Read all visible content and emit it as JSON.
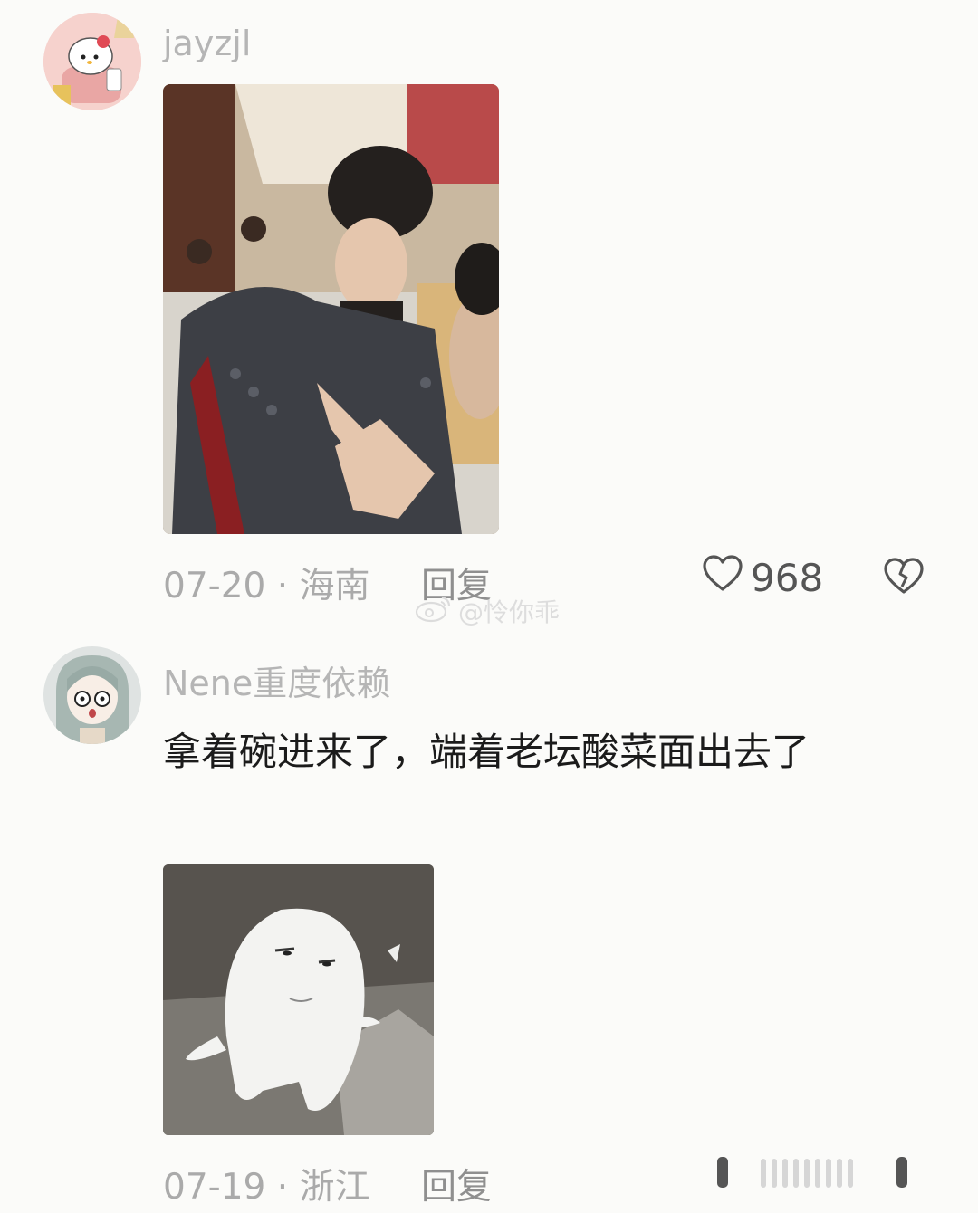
{
  "comments": [
    {
      "username": "jayzjl",
      "date": "07-20",
      "location": "海南",
      "meta_separator": " · ",
      "reply_label": "回复",
      "like_count": "968",
      "avatar_icon": "hello-kitty-avatar",
      "photo": "costume-actor-armor-photo"
    },
    {
      "username": "Nene重度依赖",
      "text": "拿着碗进来了，端着老坛酸菜面出去了",
      "date": "07-19",
      "location": "浙江",
      "meta_separator": " · ",
      "reply_label": "回复",
      "avatar_icon": "anime-girl-avatar",
      "photo": "white-plush-creature-meme"
    }
  ],
  "watermark": {
    "text": "@怜你乖",
    "icon": "weibo-icon"
  },
  "colors": {
    "meta": "#aaaaaa",
    "username": "#b5b5b5",
    "text": "#1b1b1b"
  }
}
